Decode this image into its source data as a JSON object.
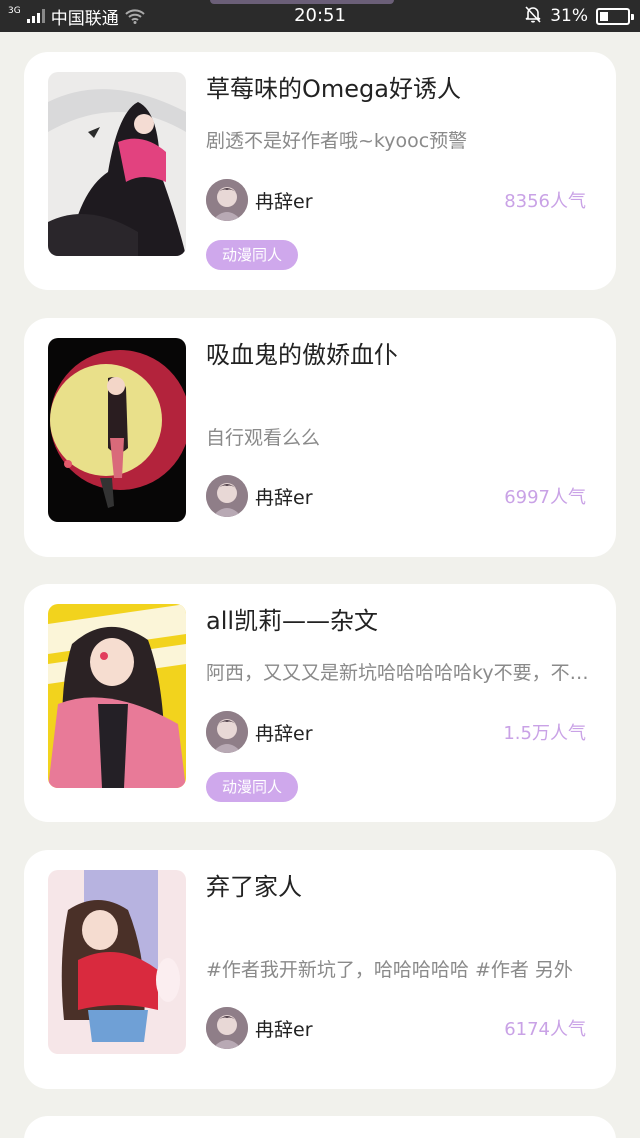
{
  "status_bar": {
    "network": "3G",
    "carrier": "中国联通",
    "time": "20:51",
    "battery": "31%",
    "battery_level": 0.31
  },
  "colors": {
    "background": "#f1f1ec",
    "card": "#ffffff",
    "accent": "#c9a2e6",
    "tag_bg": "#cfa8ec"
  },
  "stories": [
    {
      "title": "草莓味的Omega好诱人",
      "description": "剧透不是好作者哦~kyooc预警",
      "author": "冉辞er",
      "popularity": "8356人气",
      "tag": "动漫同人"
    },
    {
      "title": "吸血鬼的傲娇血仆",
      "description": "自行观看么么",
      "author": "冉辞er",
      "popularity": "6997人气",
      "tag": ""
    },
    {
      "title": "all凯莉——杂文",
      "description": "阿西，又又又是新坑哈哈哈哈哈ky不要，不要，不要",
      "author": "冉辞er",
      "popularity": "1.5万人气",
      "tag": "动漫同人"
    },
    {
      "title": "弃了家人",
      "description": "#作者我开新坑了，哈哈哈哈哈 #作者 另外",
      "author": "冉辞er",
      "popularity": "6174人气",
      "tag": ""
    }
  ]
}
